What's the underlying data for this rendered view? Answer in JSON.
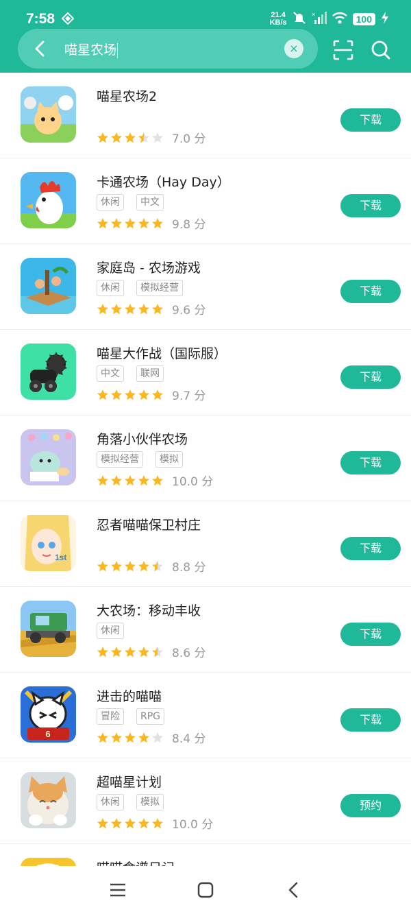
{
  "status_bar": {
    "time": "7:58",
    "net_speed_top": "21.4",
    "net_speed_bottom": "KB/s",
    "battery": "100"
  },
  "search": {
    "query": "喵星农场",
    "clear_glyph": "×"
  },
  "apps": [
    {
      "title": "喵星农场2",
      "tags": [],
      "rating": 3.5,
      "score": "7.0 分",
      "button": "下载"
    },
    {
      "title": "卡通农场（Hay Day）",
      "tags": [
        "休闲",
        "中文"
      ],
      "rating": 5,
      "score": "9.8 分",
      "button": "下载"
    },
    {
      "title": "家庭岛 - 农场游戏",
      "tags": [
        "休闲",
        "模拟经营"
      ],
      "rating": 5,
      "score": "9.6 分",
      "button": "下载"
    },
    {
      "title": "喵星大作战（国际服）",
      "tags": [
        "中文",
        "联网"
      ],
      "rating": 5,
      "score": "9.7 分",
      "button": "下载"
    },
    {
      "title": "角落小伙伴农场",
      "tags": [
        "模拟经营",
        "模拟"
      ],
      "rating": 5,
      "score": "10.0 分",
      "button": "下载"
    },
    {
      "title": "忍者喵喵保卫村庄",
      "tags": [],
      "rating": 4.5,
      "score": "8.8 分",
      "button": "下载"
    },
    {
      "title": "大农场：移动丰收",
      "tags": [
        "休闲"
      ],
      "rating": 4.5,
      "score": "8.6 分",
      "button": "下载"
    },
    {
      "title": "进击的喵喵",
      "tags": [
        "冒险",
        "RPG"
      ],
      "rating": 4,
      "score": "8.4 分",
      "button": "下载"
    },
    {
      "title": "超喵星计划",
      "tags": [
        "休闲",
        "模拟"
      ],
      "rating": 5,
      "score": "10.0 分",
      "button": "预约"
    },
    {
      "title": "喵喵食谱日记",
      "tags": [],
      "rating": 0,
      "score": "",
      "button": ""
    }
  ],
  "icons": {
    "back": "chevron-left-icon",
    "scan": "scan-icon",
    "search": "search-icon",
    "nav_menu": "menu-icon",
    "nav_home": "square-home-icon",
    "nav_back": "triangle-back-icon"
  },
  "colors": {
    "accent": "#1fb99a",
    "star": "#f9b822",
    "star_empty": "#e2e2e2"
  }
}
